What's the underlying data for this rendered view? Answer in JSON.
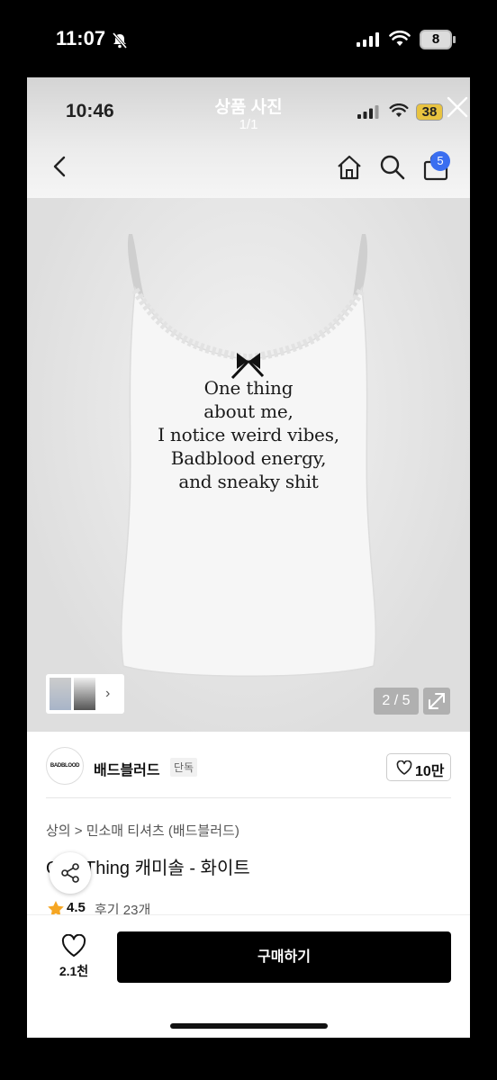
{
  "outer_status": {
    "time": "11:07",
    "battery": "8"
  },
  "inner_status": {
    "time": "10:46",
    "battery": "38"
  },
  "overlay": {
    "title": "상품 사진",
    "counter": "1/1"
  },
  "nav": {
    "cart_count": "5"
  },
  "hero": {
    "print_lines": [
      "One thing",
      "about me,",
      "I notice weird vibes,",
      "Badblood energy,",
      "and sneaky shit"
    ],
    "page_counter": "2 / 5"
  },
  "brand": {
    "logo_text": "BADBLOOD",
    "name": "배드블러드",
    "badge": "단독",
    "likes": "10만"
  },
  "product": {
    "breadcrumb": "상의 > 민소매 티셔츠 (배드블러드)",
    "title": "One Thing 캐미솔 - 화이트",
    "rating": "4.5",
    "reviews": "후기 23개"
  },
  "bottom": {
    "wish_count": "2.1천",
    "buy_label": "구매하기"
  },
  "colors": {
    "accent": "#3a6ef0",
    "star": "#f5a623",
    "buy_button": "#000000"
  }
}
